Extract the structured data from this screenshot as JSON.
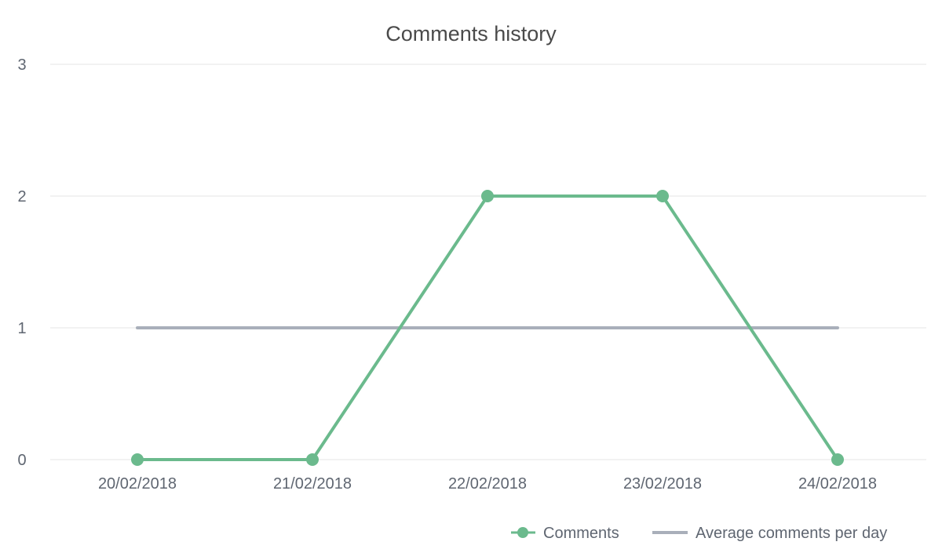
{
  "colors": {
    "comments": "#6bba8d",
    "average": "#a9afba",
    "grid": "#e6e6e6",
    "text": "#5f6671",
    "title": "#4a4a4a"
  },
  "chart_data": {
    "type": "line",
    "title": "Comments history",
    "xlabel": "",
    "ylabel": "",
    "categories": [
      "20/02/2018",
      "21/02/2018",
      "22/02/2018",
      "23/02/2018",
      "24/02/2018"
    ],
    "ylim": [
      0,
      3
    ],
    "yticks": [
      0,
      1,
      2,
      3
    ],
    "grid": true,
    "legend_position": "bottom-right",
    "series": [
      {
        "name": "Comments",
        "values": [
          0,
          0,
          2,
          2,
          0
        ],
        "markers": true,
        "color": "#6bba8d"
      },
      {
        "name": "Average comments per day",
        "values": [
          1,
          1,
          1,
          1,
          1
        ],
        "markers": false,
        "color": "#a9afba"
      }
    ]
  }
}
